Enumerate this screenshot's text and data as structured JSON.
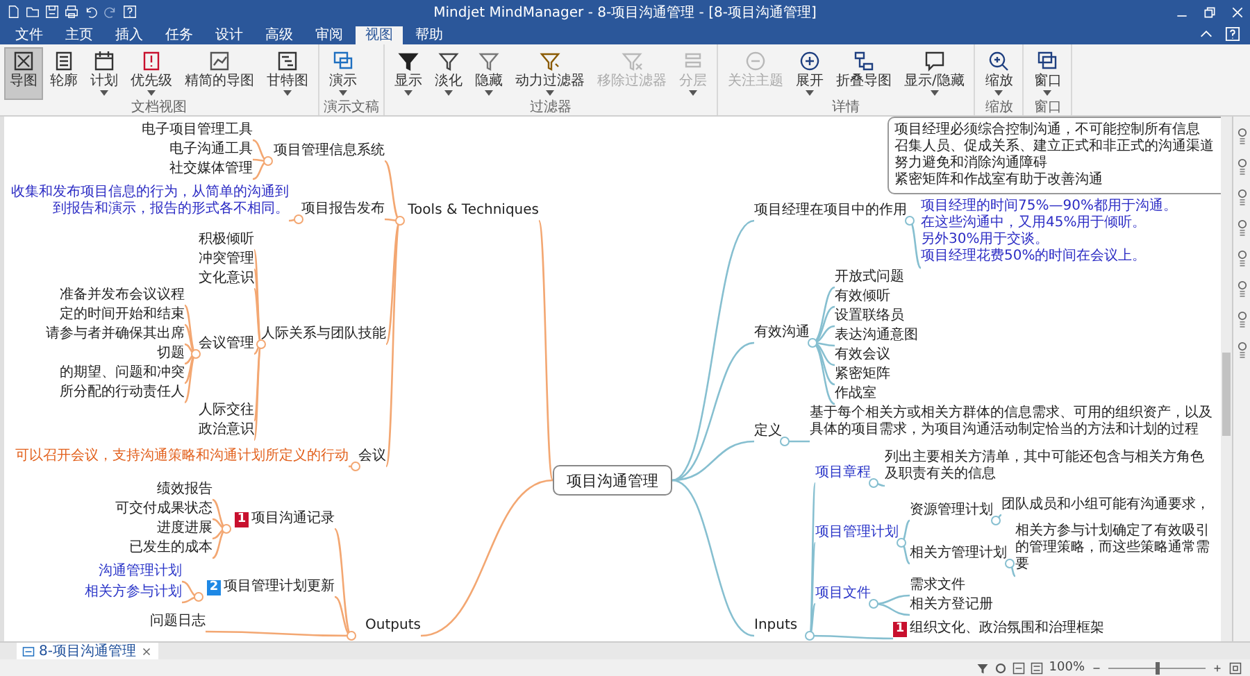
{
  "window": {
    "title": "Mindjet MindManager - 8-项目沟通管理 - [8-项目沟通管理]"
  },
  "menu_tabs": [
    {
      "label": "文件",
      "selected": false
    },
    {
      "label": "主页",
      "selected": false
    },
    {
      "label": "插入",
      "selected": false
    },
    {
      "label": "任务",
      "selected": false
    },
    {
      "label": "设计",
      "selected": false
    },
    {
      "label": "高级",
      "selected": false
    },
    {
      "label": "审阅",
      "selected": false
    },
    {
      "label": "视图",
      "selected": true
    },
    {
      "label": "帮助",
      "selected": false
    }
  ],
  "ribbon": {
    "groups": [
      {
        "label": "文档视图",
        "buttons": [
          {
            "label": "导图",
            "selected": true,
            "disabled": false,
            "dropdown": false
          },
          {
            "label": "轮廓",
            "selected": false,
            "disabled": false,
            "dropdown": false
          },
          {
            "label": "计划",
            "selected": false,
            "disabled": false,
            "dropdown": true
          },
          {
            "label": "优先级",
            "selected": false,
            "disabled": false,
            "dropdown": true
          },
          {
            "label": "精简的导图",
            "selected": false,
            "disabled": false,
            "dropdown": false
          },
          {
            "label": "甘特图",
            "selected": false,
            "disabled": false,
            "dropdown": true
          }
        ]
      },
      {
        "label": "演示文稿",
        "buttons": [
          {
            "label": "演示",
            "selected": false,
            "disabled": false,
            "dropdown": true
          }
        ]
      },
      {
        "label": "过滤器",
        "buttons": [
          {
            "label": "显示",
            "selected": false,
            "disabled": false,
            "dropdown": true
          },
          {
            "label": "淡化",
            "selected": false,
            "disabled": false,
            "dropdown": true
          },
          {
            "label": "隐藏",
            "selected": false,
            "disabled": false,
            "dropdown": true
          },
          {
            "label": "动力过滤器",
            "selected": false,
            "disabled": false,
            "dropdown": true
          },
          {
            "label": "移除过滤器",
            "selected": false,
            "disabled": true,
            "dropdown": false
          },
          {
            "label": "分层",
            "selected": false,
            "disabled": true,
            "dropdown": true
          }
        ]
      },
      {
        "label": "详情",
        "buttons": [
          {
            "label": "关注主题",
            "selected": false,
            "disabled": true,
            "dropdown": false
          },
          {
            "label": "展开",
            "selected": false,
            "disabled": false,
            "dropdown": true
          },
          {
            "label": "折叠导图",
            "selected": false,
            "disabled": false,
            "dropdown": false
          },
          {
            "label": "显示/隐藏",
            "selected": false,
            "disabled": false,
            "dropdown": true
          }
        ]
      },
      {
        "label": "缩放",
        "buttons": [
          {
            "label": "缩放",
            "selected": false,
            "disabled": false,
            "dropdown": true
          }
        ]
      },
      {
        "label": "窗口",
        "buttons": [
          {
            "label": "窗口",
            "selected": false,
            "disabled": false,
            "dropdown": true
          }
        ]
      }
    ]
  },
  "map": {
    "central_topic": "项目沟通管理",
    "top_note": {
      "lines": [
        "项目经理必须综合控制沟通，不可能控制所有信息",
        "召集人员、促成关系、建立正式和非正式的沟通渠道",
        "努力避免和消除沟通障碍",
        "紧密矩阵和作战室有助于改善沟通"
      ]
    },
    "left_topics": [
      {
        "text": "Tools & Techniques",
        "kind": "topic",
        "children": [
          {
            "text": "项目管理信息系统",
            "kind": "topic",
            "children": [
              {
                "text": "电子项目管理工具",
                "kind": "topic"
              },
              {
                "text": "电子沟通工具",
                "kind": "topic"
              },
              {
                "text": "社交媒体管理",
                "kind": "topic"
              }
            ]
          },
          {
            "text": "项目报告发布",
            "kind": "topic",
            "children": [
              {
                "kind": "note",
                "color": "#2b2bc4",
                "lines": [
                  "收集和发布项目信息的行为，从简单的沟通到",
                  "到报告和演示，报告的形式各不相同。"
                ]
              }
            ]
          },
          {
            "text": "人际关系与团队技能",
            "kind": "topic",
            "children": [
              {
                "text": "积极倾听",
                "kind": "topic"
              },
              {
                "text": "冲突管理",
                "kind": "topic"
              },
              {
                "text": "文化意识",
                "kind": "topic"
              },
              {
                "text": "会议管理",
                "kind": "topic",
                "children": [
                  {
                    "text": "准备并发布会议议程",
                    "kind": "topic"
                  },
                  {
                    "text": "定的时间开始和结束",
                    "kind": "topic"
                  },
                  {
                    "text": "请参与者并确保其出席",
                    "kind": "topic"
                  },
                  {
                    "text": "切题",
                    "kind": "topic"
                  },
                  {
                    "text": "的期望、问题和冲突",
                    "kind": "topic"
                  },
                  {
                    "text": "所分配的行动责任人",
                    "kind": "topic"
                  }
                ]
              },
              {
                "text": "人际交往",
                "kind": "topic"
              },
              {
                "text": "政治意识",
                "kind": "topic"
              }
            ]
          },
          {
            "text": "会议",
            "kind": "topic",
            "children": [
              {
                "kind": "note",
                "color": "#e2601c",
                "lines": [
                  "可以召开会议，支持沟通策略和沟通计划所定义的行动"
                ]
              }
            ]
          }
        ]
      },
      {
        "text": "Outputs",
        "kind": "topic",
        "children": [
          {
            "text": "项目沟通记录",
            "kind": "topic",
            "marker": {
              "text": "1",
              "color": "#c8102e"
            },
            "children": [
              {
                "text": "绩效报告",
                "kind": "topic"
              },
              {
                "text": "可交付成果状态",
                "kind": "topic"
              },
              {
                "text": "进度进展",
                "kind": "topic"
              },
              {
                "text": "已发生的成本",
                "kind": "topic"
              }
            ]
          },
          {
            "text": "项目管理计划更新",
            "kind": "topic",
            "marker": {
              "text": "2",
              "color": "#1e88e5"
            },
            "children": [
              {
                "text": "沟通管理计划",
                "kind": "link"
              },
              {
                "text": "相关方参与计划",
                "kind": "link"
              }
            ]
          },
          {
            "text": "问题日志",
            "kind": "topic"
          }
        ]
      }
    ],
    "right_topics": [
      {
        "text": "项目经理在项目中的作用",
        "kind": "topic",
        "children": [
          {
            "kind": "note",
            "color": "#2b2bc4",
            "lines": [
              "项目经理的时间75%—90%都用于沟通。",
              "在这些沟通中，又用45%用于倾听。",
              "另外30%用于交谈。",
              "项目经理花费50%的时间在会议上。"
            ]
          }
        ]
      },
      {
        "text": "有效沟通",
        "kind": "topic",
        "children": [
          {
            "text": "开放式问题",
            "kind": "topic"
          },
          {
            "text": "有效倾听",
            "kind": "topic"
          },
          {
            "text": "设置联络员",
            "kind": "topic"
          },
          {
            "text": "表达沟通意图",
            "kind": "topic"
          },
          {
            "text": "有效会议",
            "kind": "topic"
          },
          {
            "text": "紧密矩阵",
            "kind": "topic"
          },
          {
            "text": "作战室",
            "kind": "topic"
          }
        ]
      },
      {
        "text": "定义",
        "kind": "topic",
        "children": [
          {
            "kind": "note",
            "color": "#222222",
            "lines": [
              "基于每个相关方或相关方群体的信息需求、可用的组织资产，以及具体的项目需求，为项目沟通活动制定恰当的方法和计划的过程"
            ]
          }
        ]
      },
      {
        "text": "Inputs",
        "kind": "topic",
        "children": [
          {
            "text": "项目章程",
            "kind": "link",
            "children": [
              {
                "kind": "note",
                "color": "#222222",
                "lines": [
                  "列出主要相关方清单，其中可能还包含与相关方角色及职责有关的信息"
                ]
              }
            ]
          },
          {
            "text": "项目管理计划",
            "kind": "link",
            "children": [
              {
                "text": "资源管理计划",
                "kind": "topic",
                "children": [
                  {
                    "kind": "note",
                    "color": "#222222",
                    "lines": [
                      "团队成员和小组可能有沟通要求，"
                    ]
                  }
                ]
              },
              {
                "text": "相关方管理计划",
                "kind": "topic",
                "children": [
                  {
                    "kind": "note",
                    "color": "#222222",
                    "lines": [
                      "相关方参与计划确定了有效吸引",
                      "的管理策略，而这些策略通常需要"
                    ]
                  }
                ]
              }
            ]
          },
          {
            "text": "项目文件",
            "kind": "link",
            "children": [
              {
                "text": "需求文件",
                "kind": "topic"
              },
              {
                "text": "相关方登记册",
                "kind": "topic"
              }
            ]
          },
          {
            "text": "组织文化、政治氛围和治理框架",
            "kind": "topic",
            "marker": {
              "text": "1",
              "color": "#c8102e"
            }
          }
        ]
      }
    ]
  },
  "document_tab": {
    "label": "8-项目沟通管理",
    "selected": true
  },
  "status_bar": {
    "zoom": "100%",
    "zoom_slider": {
      "level": 0.5
    }
  }
}
